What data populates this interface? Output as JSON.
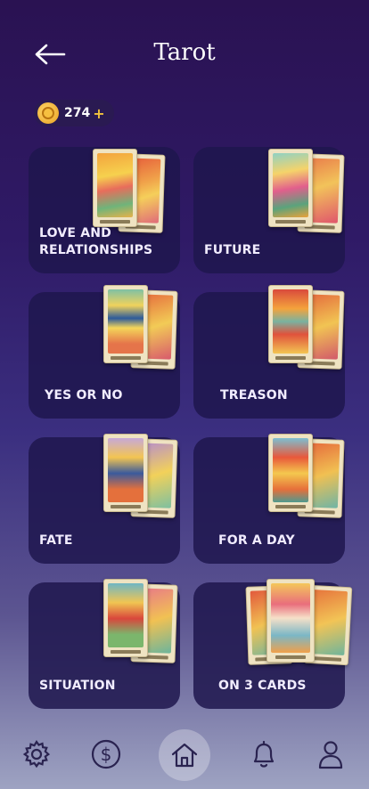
{
  "header": {
    "title": "Tarot"
  },
  "coins": {
    "value": "274",
    "plus": "+"
  },
  "categories": [
    {
      "label": "LOVE AND\nRELATIONSHIPS"
    },
    {
      "label": "FUTURE"
    },
    {
      "label": "YES OR NO"
    },
    {
      "label": "TREASON"
    },
    {
      "label": "FATE"
    },
    {
      "label": "FOR A DAY"
    },
    {
      "label": "SITUATION"
    },
    {
      "label": "ON 3 CARDS"
    }
  ],
  "nav": {
    "items": [
      "settings",
      "currency",
      "home",
      "notifications",
      "profile"
    ],
    "active": "home"
  },
  "colors": {
    "accent": "#f2c23c",
    "card_bg": "#1e164e",
    "bg_top": "#2a1252",
    "bg_bottom": "#9ea3c2"
  }
}
